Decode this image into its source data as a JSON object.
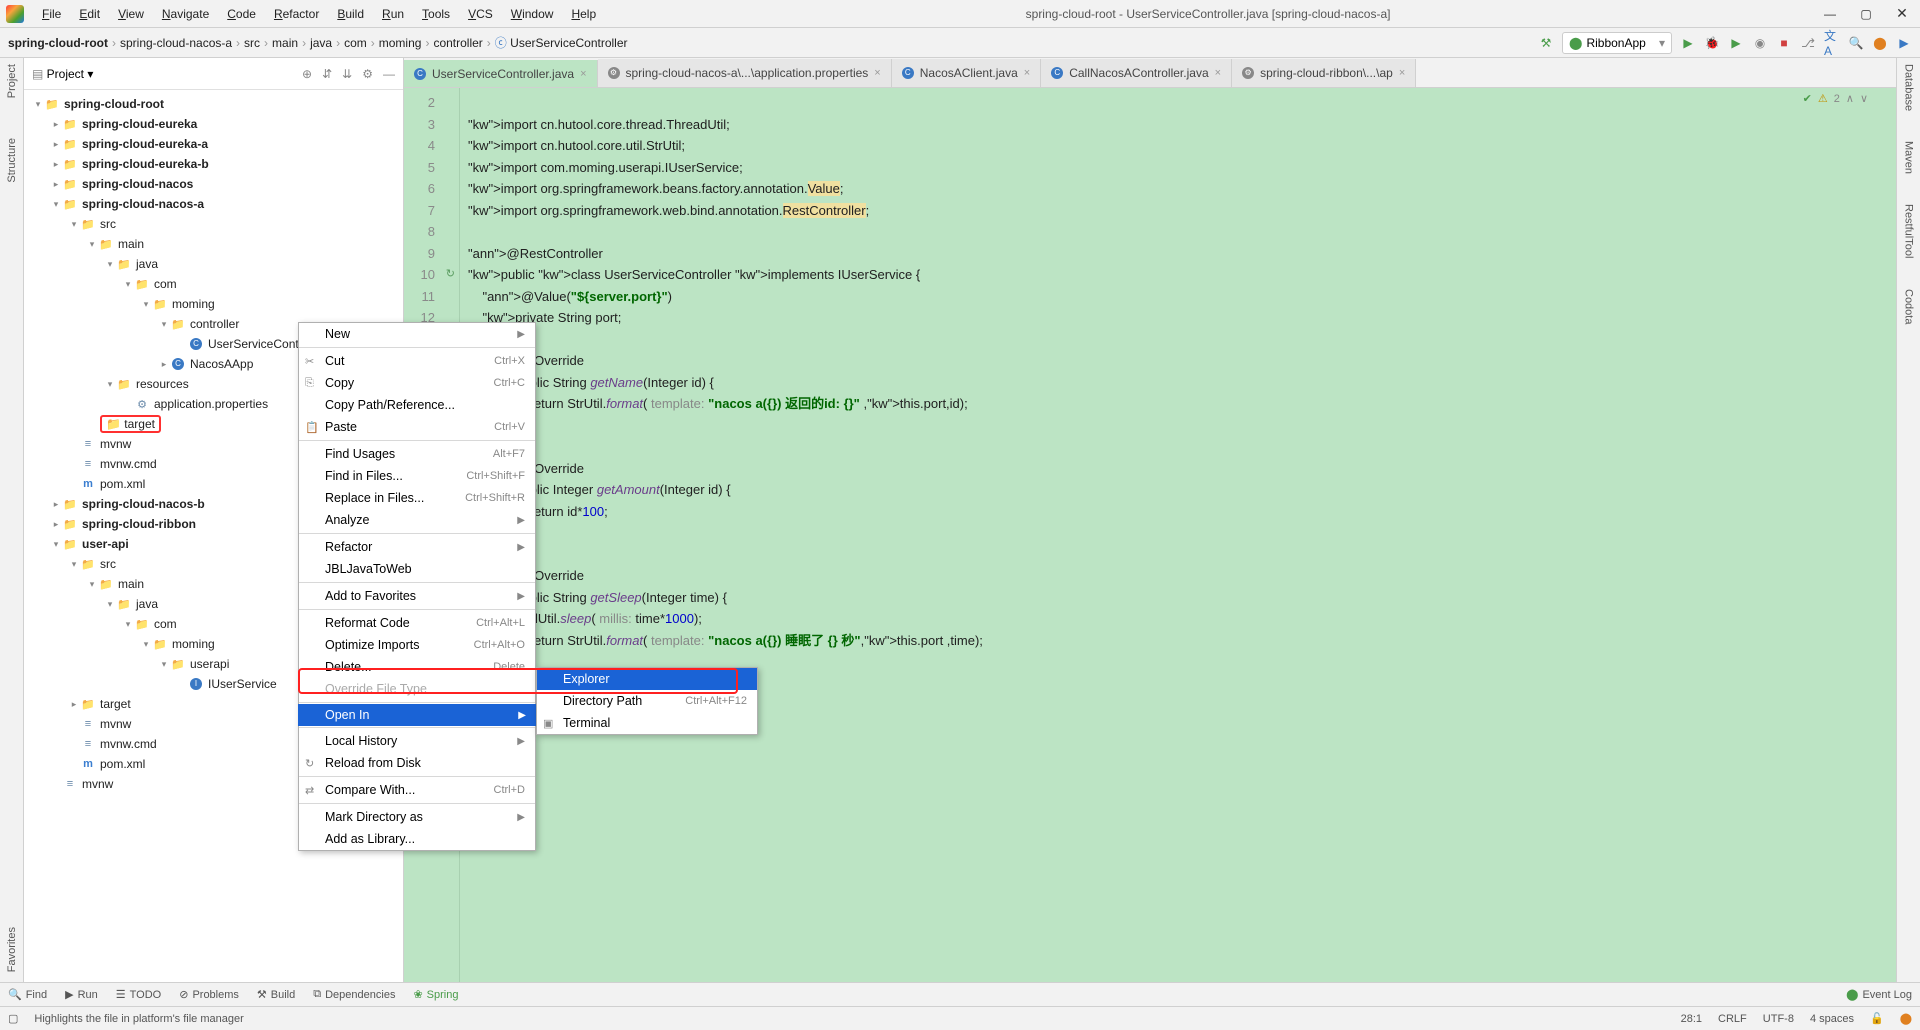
{
  "title": "spring-cloud-root - UserServiceController.java [spring-cloud-nacos-a]",
  "menus": [
    "File",
    "Edit",
    "View",
    "Navigate",
    "Code",
    "Refactor",
    "Build",
    "Run",
    "Tools",
    "VCS",
    "Window",
    "Help"
  ],
  "breadcrumb": [
    "spring-cloud-root",
    "spring-cloud-nacos-a",
    "src",
    "main",
    "java",
    "com",
    "moming",
    "controller",
    "UserServiceController"
  ],
  "runConfig": "RibbonApp",
  "project": {
    "header": "Project",
    "tree": [
      {
        "d": 0,
        "icon": "▾",
        "fico": "📁",
        "label": "spring-cloud-root",
        "bold": true
      },
      {
        "d": 1,
        "icon": "▸",
        "fico": "📁",
        "label": "spring-cloud-eureka",
        "bold": true
      },
      {
        "d": 1,
        "icon": "▸",
        "fico": "📁",
        "label": "spring-cloud-eureka-a",
        "bold": true
      },
      {
        "d": 1,
        "icon": "▸",
        "fico": "📁",
        "label": "spring-cloud-eureka-b",
        "bold": true
      },
      {
        "d": 1,
        "icon": "▸",
        "fico": "📁",
        "label": "spring-cloud-nacos",
        "bold": true
      },
      {
        "d": 1,
        "icon": "▾",
        "fico": "📁",
        "label": "spring-cloud-nacos-a",
        "bold": true
      },
      {
        "d": 2,
        "icon": "▾",
        "fico": "📁",
        "label": "src"
      },
      {
        "d": 3,
        "icon": "▾",
        "fico": "📁",
        "label": "main"
      },
      {
        "d": 4,
        "icon": "▾",
        "fico": "📁",
        "label": "java"
      },
      {
        "d": 5,
        "icon": "▾",
        "fico": "📁",
        "label": "com"
      },
      {
        "d": 6,
        "icon": "▾",
        "fico": "📁",
        "label": "moming"
      },
      {
        "d": 7,
        "icon": "▾",
        "fico": "📁",
        "label": "controller"
      },
      {
        "d": 8,
        "icon": "",
        "fico": "C",
        "label": "UserServiceCont",
        "cls": "jfile"
      },
      {
        "d": 7,
        "icon": "▸",
        "fico": "C",
        "label": "NacosAApp",
        "cls": "jfile"
      },
      {
        "d": 4,
        "icon": "▾",
        "fico": "📁",
        "label": "resources"
      },
      {
        "d": 5,
        "icon": "",
        "fico": "⚙",
        "label": "application.properties"
      },
      {
        "d": 2,
        "icon": "",
        "fico": "📁",
        "label": "target",
        "red": true
      },
      {
        "d": 2,
        "icon": "",
        "fico": "≡",
        "label": "mvnw"
      },
      {
        "d": 2,
        "icon": "",
        "fico": "≡",
        "label": "mvnw.cmd"
      },
      {
        "d": 2,
        "icon": "",
        "fico": "m",
        "label": "pom.xml",
        "cls": "mfile"
      },
      {
        "d": 1,
        "icon": "▸",
        "fico": "📁",
        "label": "spring-cloud-nacos-b",
        "bold": true
      },
      {
        "d": 1,
        "icon": "▸",
        "fico": "📁",
        "label": "spring-cloud-ribbon",
        "bold": true
      },
      {
        "d": 1,
        "icon": "▾",
        "fico": "📁",
        "label": "user-api",
        "bold": true
      },
      {
        "d": 2,
        "icon": "▾",
        "fico": "📁",
        "label": "src"
      },
      {
        "d": 3,
        "icon": "▾",
        "fico": "📁",
        "label": "main"
      },
      {
        "d": 4,
        "icon": "▾",
        "fico": "📁",
        "label": "java"
      },
      {
        "d": 5,
        "icon": "▾",
        "fico": "📁",
        "label": "com"
      },
      {
        "d": 6,
        "icon": "▾",
        "fico": "📁",
        "label": "moming"
      },
      {
        "d": 7,
        "icon": "▾",
        "fico": "📁",
        "label": "userapi"
      },
      {
        "d": 8,
        "icon": "",
        "fico": "I",
        "label": "IUserService",
        "cls": "jfile"
      },
      {
        "d": 2,
        "icon": "▸",
        "fico": "📁",
        "label": "target"
      },
      {
        "d": 2,
        "icon": "",
        "fico": "≡",
        "label": "mvnw"
      },
      {
        "d": 2,
        "icon": "",
        "fico": "≡",
        "label": "mvnw.cmd"
      },
      {
        "d": 2,
        "icon": "",
        "fico": "m",
        "label": "pom.xml",
        "cls": "mfile"
      },
      {
        "d": 1,
        "icon": "",
        "fico": "≡",
        "label": "mvnw"
      }
    ]
  },
  "tabs": [
    {
      "label": "UserServiceController.java",
      "active": true,
      "ico": "C"
    },
    {
      "label": "spring-cloud-nacos-a\\...\\application.properties",
      "ico": "⚙"
    },
    {
      "label": "NacosAClient.java",
      "ico": "C"
    },
    {
      "label": "CallNacosAController.java",
      "ico": "C"
    },
    {
      "label": "spring-cloud-ribbon\\...\\ap",
      "ico": "⚙"
    }
  ],
  "editor": {
    "startLine": 2,
    "warnings": "2",
    "lines": [
      "",
      "import cn.hutool.core.thread.ThreadUtil;",
      "import cn.hutool.core.util.StrUtil;",
      "import com.moming.userapi.IUserService;",
      "import org.springframework.beans.factory.annotation.Value;",
      "import org.springframework.web.bind.annotation.RestController;",
      "",
      "@RestController",
      "public class UserServiceController implements IUserService {",
      "    @Value(\"${server.port}\")",
      "    private String port;",
      "",
      "    @Override",
      "    public String getName(Integer id) {",
      "        return StrUtil.format( template: \"nacos a({}) 返回的id: {}\" ,this.port,id);",
      "    }",
      "",
      "    @Override",
      "    public Integer getAmount(Integer id) {",
      "        return id*100;",
      "    }",
      "",
      "    @Override",
      "    public String getSleep(Integer time) {",
      "        ThreadUtil.sleep( millis: time*1000);",
      "        return StrUtil.format( template: \"nacos a({}) 睡眠了 {} 秒\",this.port ,time);",
      "    }"
    ]
  },
  "context1": [
    {
      "label": "New",
      "arr": true
    },
    {
      "sep": true
    },
    {
      "ico": "✂",
      "label": "Cut",
      "sc": "Ctrl+X"
    },
    {
      "ico": "⎘",
      "label": "Copy",
      "sc": "Ctrl+C"
    },
    {
      "label": "Copy Path/Reference..."
    },
    {
      "ico": "📋",
      "label": "Paste",
      "sc": "Ctrl+V"
    },
    {
      "sep": true
    },
    {
      "label": "Find Usages",
      "sc": "Alt+F7"
    },
    {
      "label": "Find in Files...",
      "sc": "Ctrl+Shift+F"
    },
    {
      "label": "Replace in Files...",
      "sc": "Ctrl+Shift+R"
    },
    {
      "label": "Analyze",
      "arr": true
    },
    {
      "sep": true
    },
    {
      "label": "Refactor",
      "arr": true
    },
    {
      "label": "JBLJavaToWeb"
    },
    {
      "sep": true
    },
    {
      "label": "Add to Favorites",
      "arr": true
    },
    {
      "sep": true
    },
    {
      "label": "Reformat Code",
      "sc": "Ctrl+Alt+L"
    },
    {
      "label": "Optimize Imports",
      "sc": "Ctrl+Alt+O"
    },
    {
      "label": "Delete...",
      "sc": "Delete"
    },
    {
      "label": "Override File Type",
      "dis": true
    },
    {
      "sep": true
    },
    {
      "label": "Open In",
      "arr": true,
      "sel": true,
      "name": "ctx-open-in"
    },
    {
      "sep": true
    },
    {
      "label": "Local History",
      "arr": true
    },
    {
      "ico": "↻",
      "label": "Reload from Disk"
    },
    {
      "sep": true
    },
    {
      "ico": "⇄",
      "label": "Compare With...",
      "sc": "Ctrl+D"
    },
    {
      "sep": true
    },
    {
      "label": "Mark Directory as",
      "arr": true
    },
    {
      "label": "Add as Library..."
    }
  ],
  "context2": [
    {
      "label": "Explorer",
      "sel": true
    },
    {
      "label": "Directory Path",
      "sc": "Ctrl+Alt+F12"
    },
    {
      "ico": "▣",
      "label": "Terminal"
    }
  ],
  "leftRail": [
    "Project",
    "Structure",
    "Favorites"
  ],
  "rightRail": [
    "Database",
    "Maven",
    "RestfulTool",
    "Codota"
  ],
  "bottomBar": [
    "Find",
    "Run",
    "TODO",
    "Problems",
    "Build",
    "Dependencies",
    "Spring"
  ],
  "eventLog": "Event Log",
  "statusBar": {
    "hint": "Highlights the file in platform's file manager",
    "pos": "28:1",
    "eol": "CRLF",
    "enc": "UTF-8",
    "indent": "4 spaces"
  }
}
